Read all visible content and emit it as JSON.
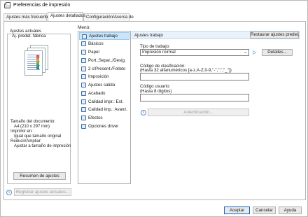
{
  "window": {
    "title": "Preferencias de impresión"
  },
  "tabs": [
    {
      "label": "Ajustes más frecuentes"
    },
    {
      "label": "Ajustes detallados"
    },
    {
      "label": "Configuración/Acerca de"
    }
  ],
  "left_panel": {
    "group_title": "Ajustes actuales",
    "preset_name": "Aj. predet. fábrica",
    "doc_size_label": "Tamaño del documento:",
    "doc_size_value": "A4 (210 x 297 mm)",
    "print_on_label": "Imprimir en:",
    "print_on_value": "Igual que tamaño original",
    "reduce_label": "Reducir/Ampliar:",
    "reduce_value": "Ajustar a tamaño de impresión",
    "summary_button": "Resumen de ajustes",
    "register_button": "Registrar ajustes actuales..."
  },
  "menu": {
    "label": "Menú:",
    "items": [
      {
        "label": "Ajustes trabajo",
        "icon": "document-settings-icon"
      },
      {
        "label": "Básicos",
        "icon": "printer-icon"
      },
      {
        "label": "Papel",
        "icon": "paper-icon"
      },
      {
        "label": "Port.,Separ.,/Desig.",
        "icon": "cover-icon"
      },
      {
        "label": "2 c/Present./Folleto",
        "icon": "duplex-icon"
      },
      {
        "label": "Imposición",
        "icon": "imposition-icon"
      },
      {
        "label": "Ajustes salida",
        "icon": "output-icon"
      },
      {
        "label": "Acabado",
        "icon": "finishing-icon"
      },
      {
        "label": "Calidad impr.: Est.",
        "icon": "quality-icon"
      },
      {
        "label": "Calidad imp.: Avanz.",
        "icon": "quality-advanced-icon"
      },
      {
        "label": "Efectos",
        "icon": "effects-icon"
      },
      {
        "label": "Opciones driver",
        "icon": "gear-icon"
      }
    ]
  },
  "job_settings": {
    "header": "Ajustes trabajo",
    "restore_button": "Restaurar ajustes predet.",
    "job_type_label": "Tipo de trabajo:",
    "job_type_value": "Impresión normal",
    "details_button": "Detalles...",
    "classification_label": "Código de clasificación:",
    "classification_hint": "(Hasta 32 alfanuméricos [a-z,A-Z,0-9,\"-\",\".\",\"_\"])",
    "classification_value": "",
    "user_code_label": "Código usuario:",
    "user_code_hint": "(Hasta 8 dígitos)",
    "user_code_value": "",
    "auth_button": "Autenticación..."
  },
  "footer": {
    "ok": "Aceptar",
    "cancel": "Cancelar",
    "help": "Ayuda"
  },
  "colors": {
    "accent": "#0a64c8",
    "selection": "#cce4f7",
    "header_bg": "#e9f2fb"
  }
}
